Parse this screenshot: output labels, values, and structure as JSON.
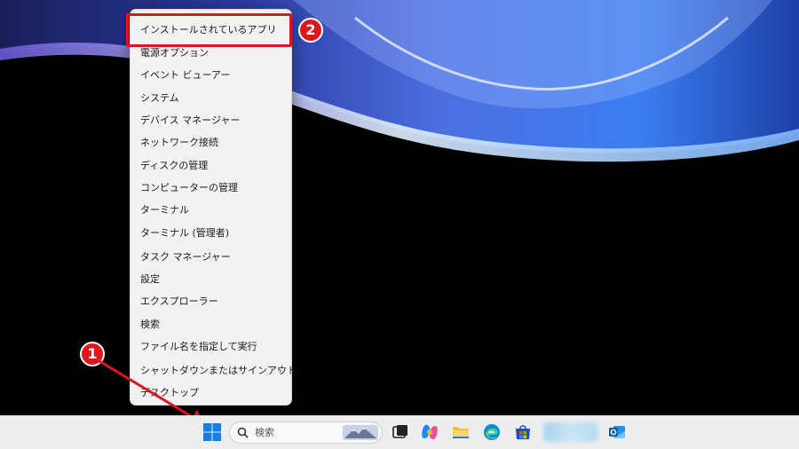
{
  "context_menu": {
    "items": [
      {
        "label": "インストールされているアプリ"
      },
      {
        "label": "電源オプション"
      },
      {
        "label": "イベント ビューアー"
      },
      {
        "label": "システム"
      },
      {
        "label": "デバイス マネージャー"
      },
      {
        "label": "ネットワーク接続"
      },
      {
        "label": "ディスクの管理"
      },
      {
        "label": "コンピューターの管理"
      },
      {
        "label": "ターミナル"
      },
      {
        "label": "ターミナル (管理者)"
      },
      {
        "label": "タスク マネージャー"
      },
      {
        "label": "設定"
      },
      {
        "label": "エクスプローラー"
      },
      {
        "label": "検索"
      },
      {
        "label": "ファイル名を指定して実行"
      },
      {
        "label": "シャットダウンまたはサインアウト",
        "submenu_arrow": "›"
      },
      {
        "label": "デスクトップ"
      }
    ]
  },
  "annotations": {
    "step1": "1",
    "step2": "2",
    "accent_color": "#e0161d"
  },
  "taskbar": {
    "search_placeholder": "検索",
    "icons": [
      "windows-start-icon",
      "search-icon",
      "task-view-icon",
      "copilot-icon",
      "file-explorer-icon",
      "edge-icon",
      "microsoft-store-icon",
      "outlook-icon"
    ]
  }
}
